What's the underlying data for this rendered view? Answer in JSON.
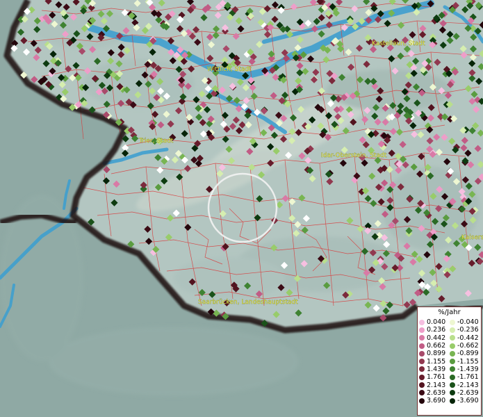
{
  "map": {
    "background_color": "#9fb7b2",
    "land_color": "#b5c8c3",
    "water_color": "#3f9fcf",
    "district_line_color": "#d93a3a",
    "border_color": "#1a1010"
  },
  "cities": [
    {
      "name": "Kastellaun, Stadt"
    },
    {
      "name": "Wittlich, Stadt"
    },
    {
      "name": "Trier, Stadt"
    },
    {
      "name": "Idar-Oberstein, Stadt"
    },
    {
      "name": "Kaisers"
    },
    {
      "name": "Saarbrücken, Landeshauptstadt"
    }
  ],
  "legend": {
    "title": "%/Jahr",
    "position": "bottom-right",
    "positive": [
      {
        "value": "0.040",
        "color": "#f6bfe0"
      },
      {
        "value": "0.236",
        "color": "#ee9ec9"
      },
      {
        "value": "0.442",
        "color": "#d97aa6"
      },
      {
        "value": "0.662",
        "color": "#c15c85"
      },
      {
        "value": "0.899",
        "color": "#a84a6a"
      },
      {
        "value": "1.155",
        "color": "#91384f"
      },
      {
        "value": "1.439",
        "color": "#7c2a3c"
      },
      {
        "value": "1.761",
        "color": "#661c2b"
      },
      {
        "value": "2.143",
        "color": "#52131f"
      },
      {
        "value": "2.639",
        "color": "#3b0b15"
      },
      {
        "value": "3.690",
        "color": "#24060c"
      }
    ],
    "negative": [
      {
        "value": "-0.040",
        "color": "#eef7d2"
      },
      {
        "value": "-0.236",
        "color": "#d6eeb0"
      },
      {
        "value": "-0.442",
        "color": "#b9df8c"
      },
      {
        "value": "-0.662",
        "color": "#98cc6a"
      },
      {
        "value": "-0.899",
        "color": "#78b552"
      },
      {
        "value": "-1.155",
        "color": "#5a9c40"
      },
      {
        "value": "-1.439",
        "color": "#3f8332"
      },
      {
        "value": "-1.761",
        "color": "#2a6a25"
      },
      {
        "value": "-2.143",
        "color": "#1a521a"
      },
      {
        "value": "-2.639",
        "color": "#0d3b10"
      },
      {
        "value": "-3.690",
        "color": "#052408"
      }
    ]
  }
}
